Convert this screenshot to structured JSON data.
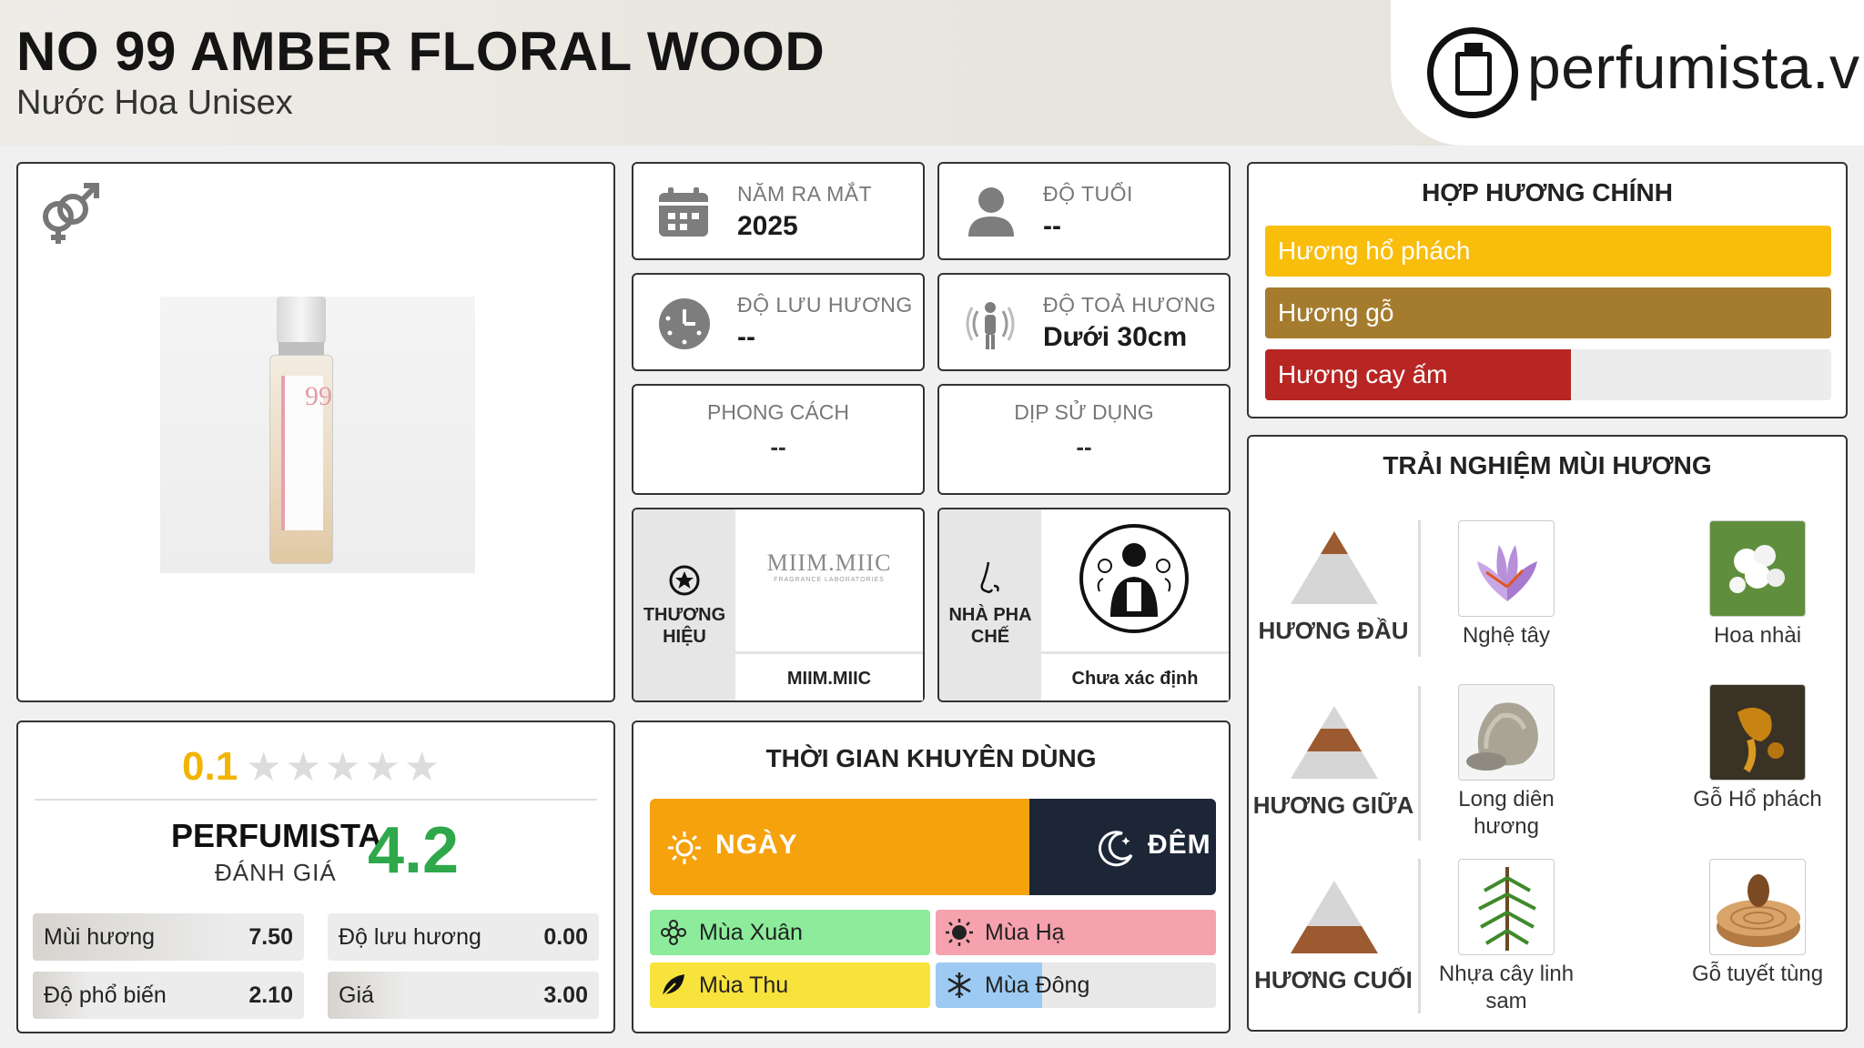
{
  "header": {
    "title": "NO 99 AMBER FLORAL WOOD",
    "subtitle": "Nước Hoa Unisex",
    "logo_text": "perfumista.vn"
  },
  "product": {
    "gender_icon": "unisex-gender-icon",
    "bottle_number": "99"
  },
  "info": {
    "release_label": "NĂM RA MẮT",
    "release_value": "2025",
    "age_label": "ĐỘ TUỔI",
    "age_value": "--",
    "longevity_label": "ĐỘ LƯU HƯƠNG",
    "longevity_value": "--",
    "sillage_label": "ĐỘ TOẢ HƯƠNG",
    "sillage_value": "Dưới 30cm",
    "style_label": "PHONG CÁCH",
    "style_value": "--",
    "occasion_label": "DỊP SỬ DỤNG",
    "occasion_value": "--",
    "brand_caption": "THƯƠNG HIỆU",
    "brand_logo_text": "MIIM.MIIC",
    "brand_logo_sub": "FRAGRANCE LABORATORIES",
    "brand_name": "MIIM.MIIC",
    "perfumer_caption": "NHÀ PHA CHẾ",
    "perfumer_name": "Chưa xác định"
  },
  "accords": {
    "title": "HỢP HƯƠNG CHÍNH",
    "items": [
      {
        "label": "Hương hổ phách",
        "color": "#f9bd0b",
        "value": 1.0
      },
      {
        "label": "Hương gỗ",
        "color": "#a57c2e",
        "value": 1.0
      },
      {
        "label": "Hương cay ấm",
        "color": "#b82624",
        "value": 0.54
      }
    ]
  },
  "experience": {
    "title": "TRẢI NGHIỆM MÙI HƯƠNG",
    "tiers": [
      {
        "label": "HƯƠNG ĐẦU",
        "notes": [
          "Nghệ tây",
          "Hoa nhài"
        ]
      },
      {
        "label": "HƯƠNG GIỮA",
        "notes": [
          "Long diên hương",
          "Gỗ Hổ phách"
        ]
      },
      {
        "label": "HƯƠNG CUỐI",
        "notes": [
          "Nhựa cây linh sam",
          "Gỗ tuyết tùng"
        ]
      }
    ]
  },
  "rating": {
    "user_score": "0.1",
    "stars_filled": 0,
    "stars_total": 5,
    "perfumista_label": "PERFUMISTA",
    "perfumista_sub": "ĐÁNH GIÁ",
    "perfumista_score": "4.2",
    "metrics": [
      {
        "label": "Mùi hương",
        "value": "7.50",
        "fraction": 0.75
      },
      {
        "label": "Độ lưu hương",
        "value": "0.00",
        "fraction": 0.0
      },
      {
        "label": "Độ phổ biến",
        "value": "2.10",
        "fraction": 0.21
      },
      {
        "label": "Giá",
        "value": "3.00",
        "fraction": 0.3
      }
    ]
  },
  "time": {
    "title": "THỜI GIAN KHUYÊN DÙNG",
    "day_label": "NGÀY",
    "night_label": "ĐÊM",
    "day_fraction": 0.67,
    "seasons": [
      {
        "label": "Mùa Xuân",
        "color": "#8cec9c",
        "value": 1.0
      },
      {
        "label": "Mùa Hạ",
        "color": "#f6a2ae",
        "value": 1.0
      },
      {
        "label": "Mùa Thu",
        "color": "#f8e33c",
        "value": 1.0
      },
      {
        "label": "Mùa Đông",
        "color": "#9ccaf2",
        "value": 0.38
      }
    ]
  }
}
